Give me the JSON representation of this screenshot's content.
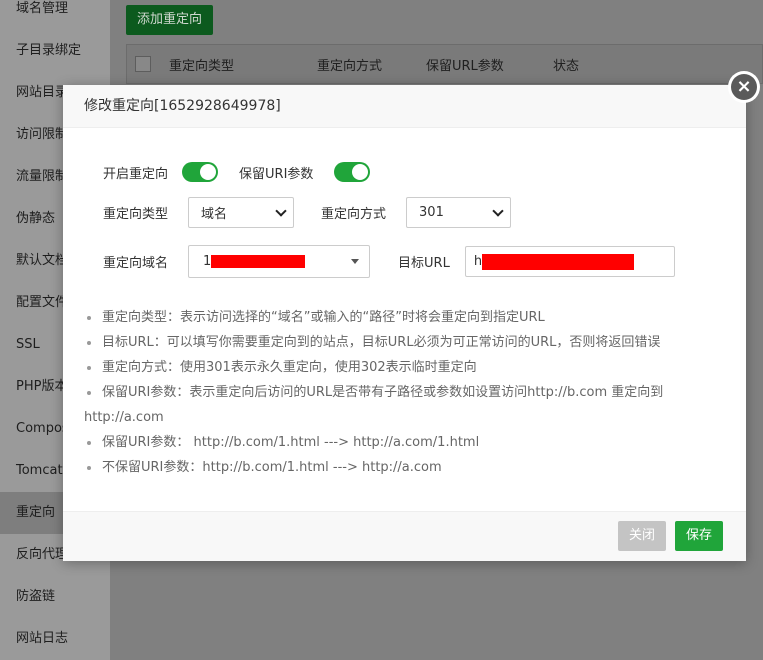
{
  "sidebar": {
    "items": [
      {
        "label": "域名管理",
        "active": false
      },
      {
        "label": "子目录绑定",
        "active": false
      },
      {
        "label": "网站目录",
        "active": false
      },
      {
        "label": "访问限制",
        "active": false
      },
      {
        "label": "流量限制",
        "active": false
      },
      {
        "label": "伪静态",
        "active": false
      },
      {
        "label": "默认文档",
        "active": false
      },
      {
        "label": "配置文件",
        "active": false
      },
      {
        "label": "SSL",
        "active": false
      },
      {
        "label": "PHP版本",
        "active": false
      },
      {
        "label": "Composer",
        "active": false
      },
      {
        "label": "Tomcat",
        "active": false
      },
      {
        "label": "重定向",
        "active": true
      },
      {
        "label": "反向代理",
        "active": false
      },
      {
        "label": "防盗链",
        "active": false
      },
      {
        "label": "网站日志",
        "active": false
      }
    ]
  },
  "background": {
    "add_button": "添加重定向",
    "columns": [
      "重定向类型",
      "重定向方式",
      "保留URL参数",
      "状态"
    ]
  },
  "modal": {
    "title": "修改重定向[1652928649978]",
    "enable_label": "开启重定向",
    "enable_on": true,
    "keep_uri_label": "保留URI参数",
    "keep_uri_on": true,
    "type_label": "重定向类型",
    "type_value": "域名",
    "method_label": "重定向方式",
    "method_value": "301",
    "domain_label": "重定向域名",
    "domain_prefix": "1",
    "target_label": "目标URL",
    "target_prefix": "h",
    "tips": [
      "重定向类型：表示访问选择的“域名”或输入的“路径”时将会重定向到指定URL",
      "目标URL：可以填写你需要重定向到的站点，目标URL必须为可正常访问的URL，否则将返回错误",
      "重定向方式：使用301表示永久重定向，使用302表示临时重定向",
      "保留URI参数：表示重定向后访问的URL是否带有子路径或参数如设置访问http://b.com 重定向到http://a.com",
      "保留URI参数： http://b.com/1.html ---> http://a.com/1.html",
      "不保留URI参数：http://b.com/1.html ---> http://a.com"
    ],
    "close_label": "关闭",
    "save_label": "保存"
  },
  "colors": {
    "accent": "#20a53a",
    "redaction": "#ff0000"
  }
}
